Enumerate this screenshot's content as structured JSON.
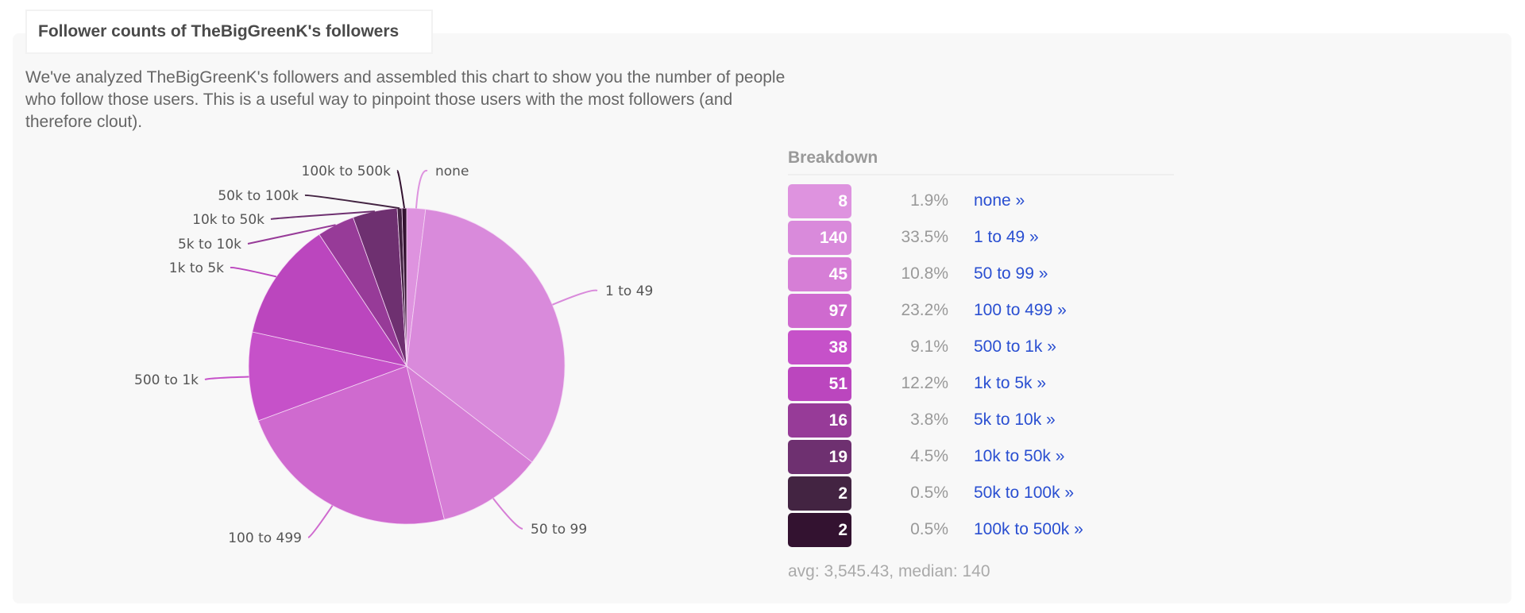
{
  "header": {
    "title": "Follower counts of TheBigGreenK's followers"
  },
  "description": "We've analyzed TheBigGreenK's followers and assembled this chart to show you the number of people who follow those users. This is a useful way to pinpoint those users with the most followers (and therefore clout).",
  "breakdown": {
    "heading": "Breakdown",
    "rows": [
      {
        "count": "8",
        "percent": "1.9%",
        "label": "none »"
      },
      {
        "count": "140",
        "percent": "33.5%",
        "label": "1 to 49 »"
      },
      {
        "count": "45",
        "percent": "10.8%",
        "label": "50 to 99 »"
      },
      {
        "count": "97",
        "percent": "23.2%",
        "label": "100 to 499 »"
      },
      {
        "count": "38",
        "percent": "9.1%",
        "label": "500 to 1k »"
      },
      {
        "count": "51",
        "percent": "12.2%",
        "label": "1k to 5k »"
      },
      {
        "count": "16",
        "percent": "3.8%",
        "label": "5k to 10k »"
      },
      {
        "count": "19",
        "percent": "4.5%",
        "label": "10k to 50k »"
      },
      {
        "count": "2",
        "percent": "0.5%",
        "label": "50k to 100k »"
      },
      {
        "count": "2",
        "percent": "0.5%",
        "label": "100k to 500k »"
      }
    ],
    "stats": "avg: 3,545.43, median: 140"
  },
  "chart_data": {
    "type": "pie",
    "title": "Follower counts of TheBigGreenK's followers",
    "start": "12 o'clock, clockwise",
    "categories": [
      "none",
      "1 to 49",
      "50 to 99",
      "100 to 499",
      "500 to 1k",
      "1k to 5k",
      "5k to 10k",
      "10k to 50k",
      "50k to 100k",
      "100k to 500k"
    ],
    "values": [
      8,
      140,
      45,
      97,
      38,
      51,
      16,
      19,
      2,
      2
    ],
    "percents": [
      1.9,
      33.5,
      10.8,
      23.2,
      9.1,
      12.2,
      3.8,
      4.5,
      0.5,
      0.5
    ],
    "colors": [
      "#de93df",
      "#d98adb",
      "#d67ed6",
      "#cf6acf",
      "#c651c9",
      "#bb46be",
      "#973b98",
      "#6e3070",
      "#432442",
      "#331230"
    ],
    "legend": "right"
  }
}
